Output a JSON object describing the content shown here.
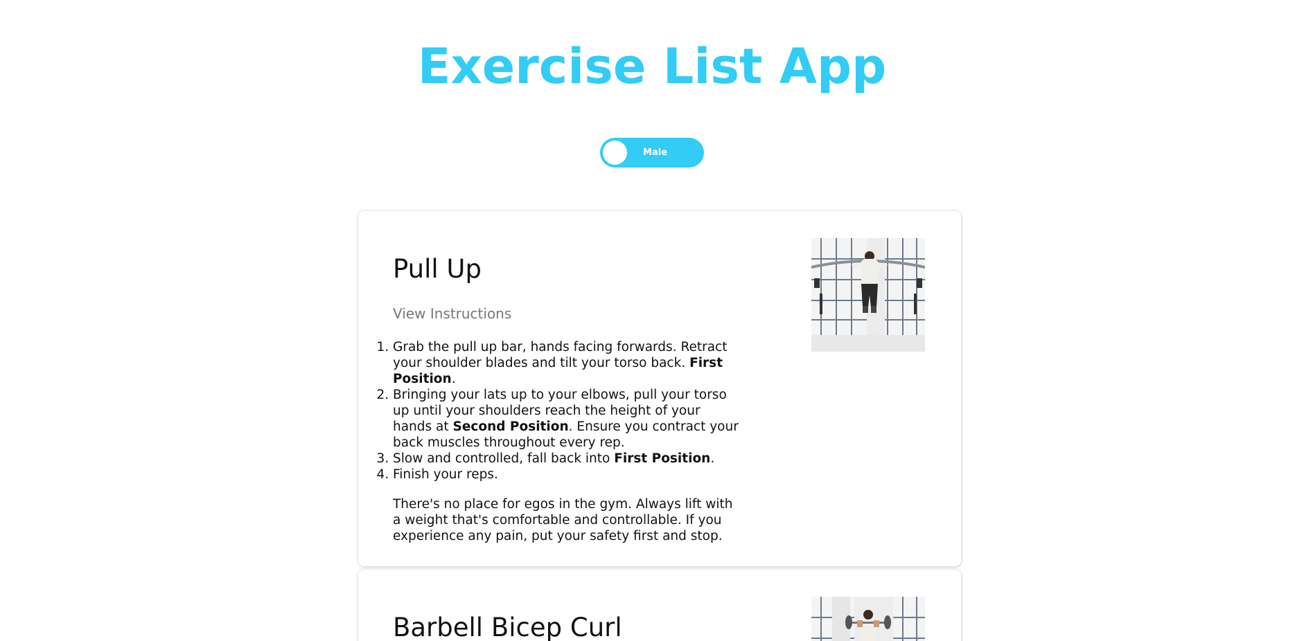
{
  "app": {
    "title": "Exercise List App",
    "accent_color": "#33ccf5"
  },
  "gender_toggle": {
    "label": "Male",
    "state": "male"
  },
  "exercises": [
    {
      "title": "Pull Up",
      "view_instructions_label": "View Instructions",
      "image_icon": "pull-up-photo",
      "steps": [
        {
          "before": "Grab the pull up bar, hands facing forwards. Retract your shoulder blades and tilt your torso back. ",
          "bold": "First Position",
          "after": "."
        },
        {
          "before": "Bringing your lats up to your elbows, pull your torso up until your shoulders reach the height of your hands at ",
          "bold": "Second Position",
          "after": ". Ensure you contract your back muscles throughout every rep."
        },
        {
          "before": "Slow and controlled, fall back into ",
          "bold": "First Position",
          "after": "."
        },
        {
          "before": "Finish your reps.",
          "bold": "",
          "after": ""
        }
      ],
      "note": "There's no place for egos in the gym. Always lift with a weight that's comfortable and controllable. If you experience any pain, put your safety first and stop."
    },
    {
      "title": "Barbell Bicep Curl",
      "image_icon": "barbell-curl-photo"
    }
  ]
}
